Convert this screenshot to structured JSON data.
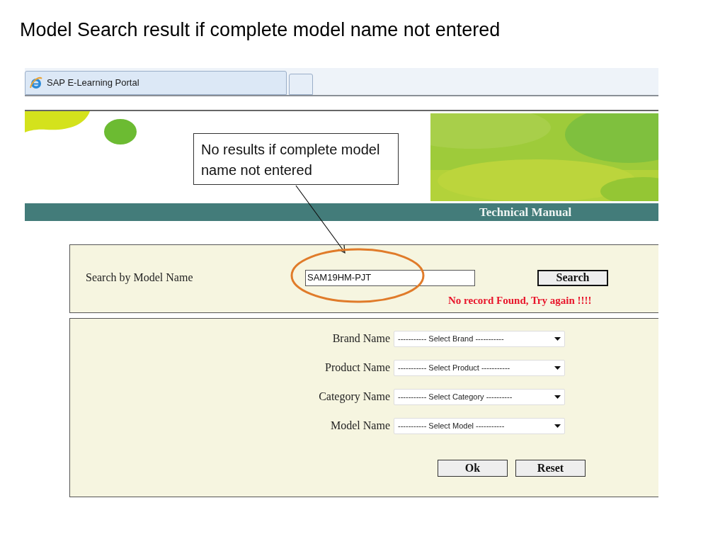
{
  "slide_title": "Model Search result if complete model name not entered",
  "browser": {
    "tab_title": "SAP E-Learning Portal"
  },
  "header": {
    "banner_title": "Technical Manual"
  },
  "callout": {
    "text": "No results if complete model name not entered"
  },
  "search": {
    "label": "Search by Model Name",
    "value": "SAM19HM-PJT",
    "button": "Search",
    "message": "No record Found, Try again !!!!",
    "highlighted": true
  },
  "filters": [
    {
      "label": "Brand Name",
      "value": "----------- Select Brand -----------"
    },
    {
      "label": "Product Name",
      "value": "----------- Select Product -----------"
    },
    {
      "label": "Category Name",
      "value": "----------- Select Category ----------"
    },
    {
      "label": "Model Name",
      "value": "----------- Select Model -----------"
    }
  ],
  "buttons": [
    "Ok",
    "Reset"
  ]
}
